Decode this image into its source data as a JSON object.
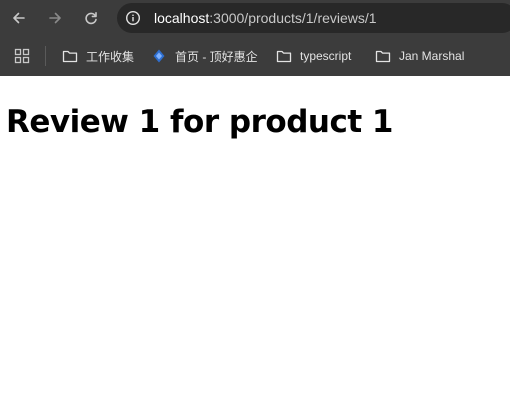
{
  "browser": {
    "address": {
      "host": "localhost",
      "path": ":3000/products/1/reviews/1"
    },
    "bookmarks": [
      {
        "label": "工作收集",
        "icon": "folder-icon"
      },
      {
        "label": "首页 - 顶好惠企",
        "icon": "site-favicon-icon"
      },
      {
        "label": "typescript",
        "icon": "folder-icon"
      },
      {
        "label": "Jan Marshal",
        "icon": "folder-icon"
      }
    ]
  },
  "page": {
    "heading": "Review 1 for product 1"
  }
}
